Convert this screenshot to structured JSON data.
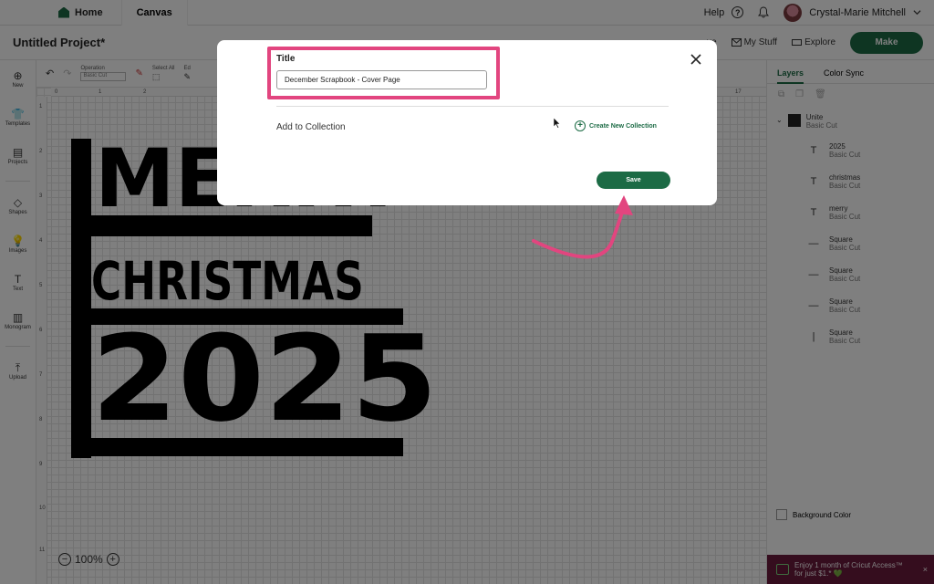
{
  "topbar": {
    "home_label": "Home",
    "canvas_label": "Canvas",
    "help_label": "Help",
    "user_name": "Crystal-Marie Mitchell"
  },
  "project": {
    "title": "Untitled Project*",
    "save_label": "ve",
    "my_stuff_label": "My Stuff",
    "explore_label": "Explore",
    "make_label": "Make"
  },
  "editbar": {
    "operation_label": "Operation",
    "operation_value": "Basic Cut",
    "select_all_label": "Select All",
    "edit_label": "Ed"
  },
  "sidebar": {
    "items": [
      {
        "label": "New",
        "icon": "plus-circle-icon",
        "glyph": "⊕"
      },
      {
        "label": "Templates",
        "icon": "shirt-icon",
        "glyph": "👕"
      },
      {
        "label": "Projects",
        "icon": "projects-icon",
        "glyph": "▤"
      },
      {
        "label": "Shapes",
        "icon": "shapes-icon",
        "glyph": "◇"
      },
      {
        "label": "Images",
        "icon": "images-icon",
        "glyph": "💡"
      },
      {
        "label": "Text",
        "icon": "text-icon",
        "glyph": "T"
      },
      {
        "label": "Monogram",
        "icon": "monogram-icon",
        "glyph": "▥"
      },
      {
        "label": "Upload",
        "icon": "upload-icon",
        "glyph": "⤒"
      }
    ]
  },
  "ruler": {
    "top": [
      "0",
      "1",
      "2",
      "17"
    ],
    "left": [
      "1",
      "2",
      "3",
      "4",
      "5",
      "6",
      "7",
      "8",
      "9",
      "10",
      "11"
    ]
  },
  "design": {
    "line1": "MERRY",
    "line2": "CHRISTMAS",
    "line3": "2025"
  },
  "zoom": {
    "minus": "−",
    "value": "100%",
    "plus": "+"
  },
  "layers_panel": {
    "tab_layers": "Layers",
    "tab_color_sync": "Color Sync",
    "group_name": "Unite",
    "group_type": "Basic Cut",
    "layers": [
      {
        "name": "2025",
        "type": "Basic Cut",
        "icon": "T"
      },
      {
        "name": "christmas",
        "type": "Basic Cut",
        "icon": "T"
      },
      {
        "name": "merry",
        "type": "Basic Cut",
        "icon": "T"
      },
      {
        "name": "Square",
        "type": "Basic Cut",
        "icon": "—"
      },
      {
        "name": "Square",
        "type": "Basic Cut",
        "icon": "—"
      },
      {
        "name": "Square",
        "type": "Basic Cut",
        "icon": "—"
      },
      {
        "name": "Square",
        "type": "Basic Cut",
        "icon": "|"
      }
    ],
    "background_color_label": "Background Color",
    "promo_line1": "Enjoy 1 month of Cricut Access™",
    "promo_line2": "for just $1.* 💚",
    "promo_close": "×"
  },
  "modal": {
    "title_label": "Title",
    "title_value": "December Scrapbook - Cover Page",
    "collection_label": "Add to Collection",
    "create_collection_label": "Create New Collection",
    "save_label": "Save"
  },
  "colors": {
    "brand_green": "#1c6b45",
    "highlight_pink": "#e2457f",
    "promo_bg": "#6a1a3d"
  }
}
